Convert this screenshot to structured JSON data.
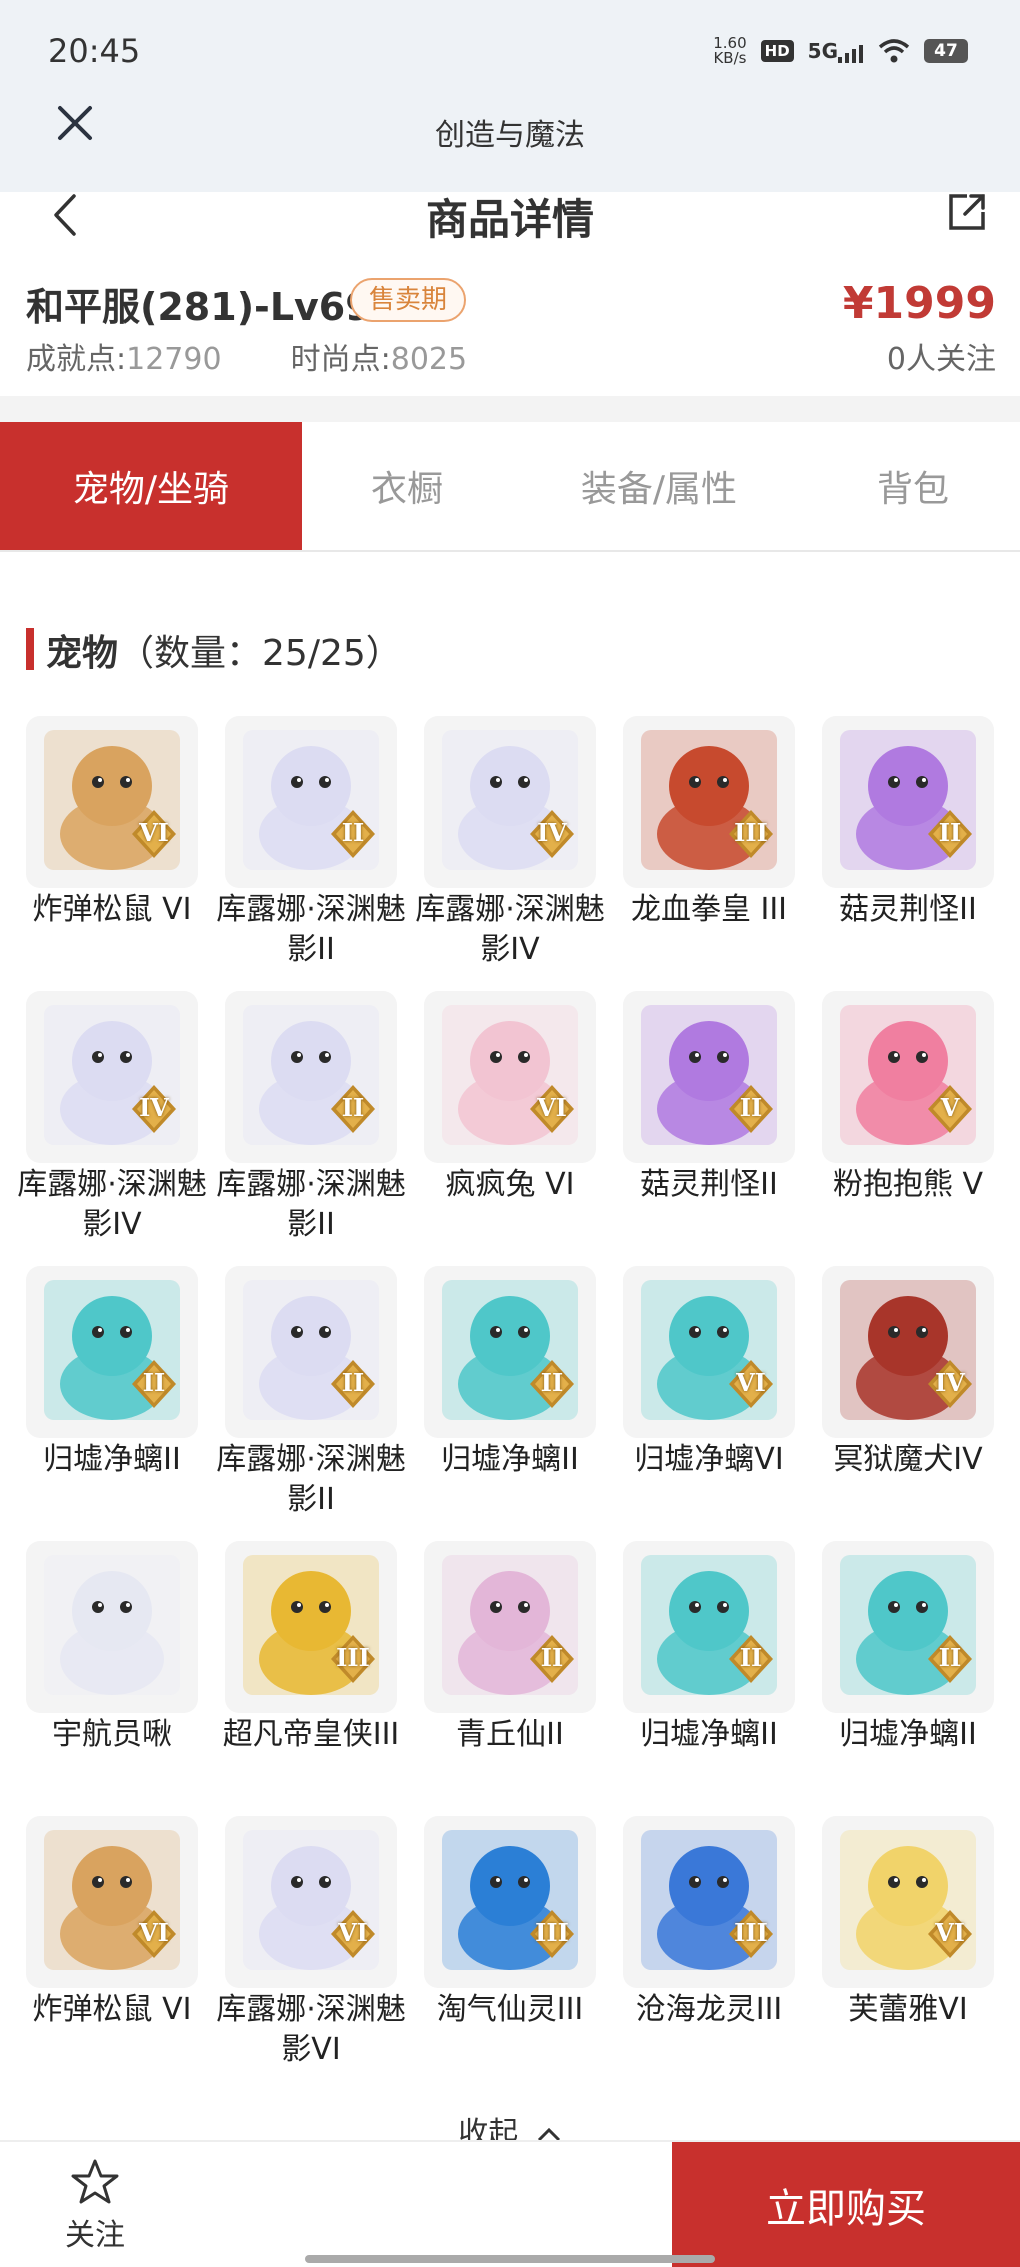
{
  "status_bar": {
    "time": "20:45",
    "speed": "1.60",
    "speed_unit": "KB/s",
    "hd": "HD",
    "network": "5G",
    "battery": "47"
  },
  "webview": {
    "title": "创造与魔法",
    "close_icon": "close-icon"
  },
  "page": {
    "title": "商品详情",
    "back_icon": "chevron-left-icon",
    "share_icon": "share-icon"
  },
  "product": {
    "name": "和平服(281)-Lv69",
    "badge": "售卖期",
    "price": "¥1999",
    "achievement_label": "成就点:",
    "achievement_value": "12790",
    "fashion_label": "时尚点:",
    "fashion_value": "8025",
    "followers": "0人关注"
  },
  "tabs": [
    {
      "label": "宠物/坐骑",
      "active": true
    },
    {
      "label": "衣橱",
      "active": false
    },
    {
      "label": "装备/属性",
      "active": false
    },
    {
      "label": "背包",
      "active": false
    }
  ],
  "section": {
    "title": "宠物",
    "count": "（数量：25/25）"
  },
  "pets": [
    {
      "name": "炸弹松鼠 VI",
      "rank": "VI",
      "icon": "squirrel-icon",
      "color": "#d9a35f"
    },
    {
      "name": "库露娜·深渊魅影II",
      "rank": "II",
      "icon": "kuluna-icon",
      "color": "#dcdcf2"
    },
    {
      "name": "库露娜·深渊魅影IV",
      "rank": "IV",
      "icon": "kuluna-icon",
      "color": "#dcdcf2"
    },
    {
      "name": "龙血拳皇 III",
      "rank": "III",
      "icon": "dragon-fist-icon",
      "color": "#c74a2e"
    },
    {
      "name": "菇灵荆怪II",
      "rank": "II",
      "icon": "mushroom-spirit-icon",
      "color": "#b07ae0"
    },
    {
      "name": "库露娜·深渊魅影IV",
      "rank": "IV",
      "icon": "kuluna-icon",
      "color": "#dcdcf2"
    },
    {
      "name": "库露娜·深渊魅影II",
      "rank": "II",
      "icon": "kuluna-icon",
      "color": "#dcdcf2"
    },
    {
      "name": "疯疯兔 VI",
      "rank": "VI",
      "icon": "rabbit-icon",
      "color": "#f2c4d2"
    },
    {
      "name": "菇灵荆怪II",
      "rank": "II",
      "icon": "mushroom-spirit-icon",
      "color": "#b07ae0"
    },
    {
      "name": "粉抱抱熊 V",
      "rank": "V",
      "icon": "pink-bear-icon",
      "color": "#f07fa0"
    },
    {
      "name": "归墟净螭II",
      "rank": "II",
      "icon": "sea-dragon-icon",
      "color": "#4fc7c9"
    },
    {
      "name": "库露娜·深渊魅影II",
      "rank": "II",
      "icon": "kuluna-icon",
      "color": "#dcdcf2"
    },
    {
      "name": "归墟净螭II",
      "rank": "II",
      "icon": "sea-dragon-icon",
      "color": "#4fc7c9"
    },
    {
      "name": "归墟净螭VI",
      "rank": "VI",
      "icon": "sea-dragon-icon",
      "color": "#4fc7c9"
    },
    {
      "name": "冥狱魔犬IV",
      "rank": "IV",
      "icon": "hell-hound-icon",
      "color": "#a8352a"
    },
    {
      "name": "宇航员啾",
      "rank": "",
      "icon": "astronaut-icon",
      "color": "#e6e8f2"
    },
    {
      "name": "超凡帝皇侠III",
      "rank": "III",
      "icon": "emperor-hero-icon",
      "color": "#e8b833"
    },
    {
      "name": "青丘仙II",
      "rank": "II",
      "icon": "fox-fairy-icon",
      "color": "#e3b6d8"
    },
    {
      "name": "归墟净螭II",
      "rank": "II",
      "icon": "sea-dragon-icon",
      "color": "#4fc7c9"
    },
    {
      "name": "归墟净螭II",
      "rank": "II",
      "icon": "sea-dragon-icon",
      "color": "#4fc7c9"
    },
    {
      "name": "炸弹松鼠 VI",
      "rank": "VI",
      "icon": "squirrel-icon",
      "color": "#d9a35f"
    },
    {
      "name": "库露娜·深渊魅影VI",
      "rank": "VI",
      "icon": "kuluna-icon",
      "color": "#dcdcf2"
    },
    {
      "name": "淘气仙灵III",
      "rank": "III",
      "icon": "blue-pup-icon",
      "color": "#2b7fd6"
    },
    {
      "name": "沧海龙灵III",
      "rank": "III",
      "icon": "sea-dragon-spirit-icon",
      "color": "#3a78d8"
    },
    {
      "name": "芙蕾雅VI",
      "rank": "VI",
      "icon": "freya-icon",
      "color": "#f1d36a"
    }
  ],
  "collapse_label": "收起",
  "bottom": {
    "follow_label": "关注",
    "follow_icon": "star-icon",
    "buy_label": "立即购买"
  },
  "colors": {
    "accent": "#c8302d",
    "price": "#c13a35",
    "badge": "#d9853c"
  }
}
